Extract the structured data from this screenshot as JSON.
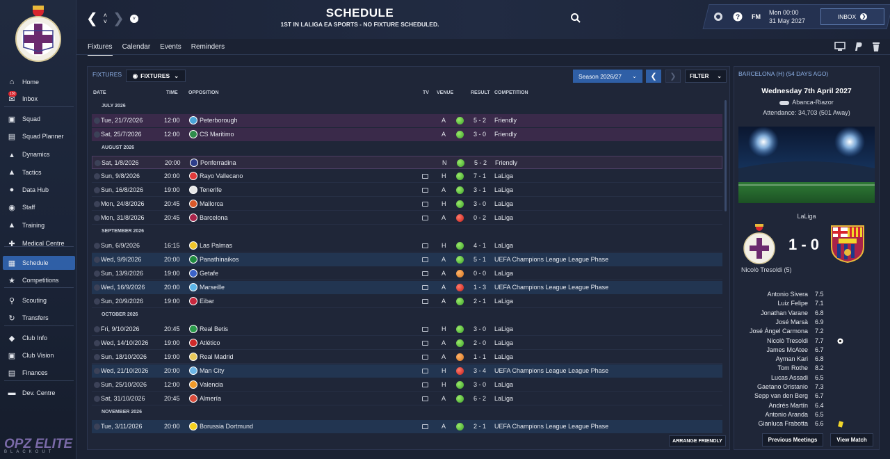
{
  "sidebar": {
    "items": [
      {
        "label": "Home",
        "icon": "home-icon"
      },
      {
        "label": "Inbox",
        "icon": "inbox-icon",
        "badge": "150"
      },
      {
        "label": "Squad",
        "icon": "shirt-icon"
      },
      {
        "label": "Squad Planner",
        "icon": "planner-icon"
      },
      {
        "label": "Dynamics",
        "icon": "dynamics-icon"
      },
      {
        "label": "Tactics",
        "icon": "tactics-icon"
      },
      {
        "label": "Data Hub",
        "icon": "data-hub-icon"
      },
      {
        "label": "Staff",
        "icon": "staff-icon"
      },
      {
        "label": "Training",
        "icon": "training-icon"
      },
      {
        "label": "Medical Centre",
        "icon": "medical-icon"
      },
      {
        "label": "Schedule",
        "icon": "calendar-icon",
        "active": true
      },
      {
        "label": "Competitions",
        "icon": "trophy-icon"
      },
      {
        "label": "Scouting",
        "icon": "scouting-icon"
      },
      {
        "label": "Transfers",
        "icon": "transfers-icon"
      },
      {
        "label": "Club Info",
        "icon": "club-info-icon"
      },
      {
        "label": "Club Vision",
        "icon": "club-vision-icon"
      },
      {
        "label": "Finances",
        "icon": "finances-icon"
      },
      {
        "label": "Dev. Centre",
        "icon": "dev-centre-icon"
      }
    ],
    "brand_main": "OPZ ELITE",
    "brand_sub": "BLACKOUT"
  },
  "header": {
    "title": "SCHEDULE",
    "subtitle": "1ST IN LALIGA EA SPORTS - NO FIXTURE SCHEDULED.",
    "fm_label": "FM",
    "day_time": "Mon 00:00",
    "date": "31 May 2027",
    "inbox_label": "INBOX"
  },
  "tabs": [
    "Fixtures",
    "Calendar",
    "Events",
    "Reminders"
  ],
  "panel": {
    "label": "FIXTURES",
    "view_dropdown": "FIXTURES",
    "season": "Season 2026/27",
    "filter": "FILTER",
    "arrange_label": "ARRANGE FRIENDLY",
    "columns": {
      "date": "DATE",
      "time": "TIME",
      "opposition": "OPPOSITION",
      "tv": "TV",
      "venue": "VENUE",
      "result": "RESULT",
      "competition": "COMPETITION"
    }
  },
  "fixtures": [
    {
      "section": "JULY 2026"
    },
    {
      "date": "Tue, 21/7/2026",
      "time": "12:00",
      "opp": "Peterborough",
      "tv": false,
      "venue": "A",
      "outcome": "win",
      "result": "5 - 2",
      "comp": "Friendly",
      "style": "friendly",
      "logo": "#4aa4d8"
    },
    {
      "date": "Sat, 25/7/2026",
      "time": "12:00",
      "opp": "CS Maritimo",
      "tv": false,
      "venue": "A",
      "outcome": "win",
      "result": "3 - 0",
      "comp": "Friendly",
      "style": "friendly",
      "logo": "#2e8b4a"
    },
    {
      "section": "AUGUST 2026"
    },
    {
      "date": "Sat, 1/8/2026",
      "time": "20:00",
      "opp": "Ponferradina",
      "tv": false,
      "venue": "N",
      "outcome": "win",
      "result": "5 - 2",
      "comp": "Friendly",
      "style": "friendly-light",
      "logo": "#2d3d8a"
    },
    {
      "date": "Sun, 9/8/2026",
      "time": "20:00",
      "opp": "Rayo Vallecano",
      "tv": true,
      "venue": "H",
      "outcome": "win",
      "result": "7 - 1",
      "comp": "LaLiga",
      "style": "plain",
      "logo": "#e23a3a"
    },
    {
      "date": "Sun, 16/8/2026",
      "time": "19:00",
      "opp": "Tenerife",
      "tv": true,
      "venue": "A",
      "outcome": "win",
      "result": "3 - 1",
      "comp": "LaLiga",
      "style": "plain",
      "logo": "#e7e7e7"
    },
    {
      "date": "Mon, 24/8/2026",
      "time": "20:45",
      "opp": "Mallorca",
      "tv": true,
      "venue": "H",
      "outcome": "win",
      "result": "3 - 0",
      "comp": "LaLiga",
      "style": "plain",
      "logo": "#d8582a"
    },
    {
      "date": "Mon, 31/8/2026",
      "time": "20:45",
      "opp": "Barcelona",
      "tv": true,
      "venue": "A",
      "outcome": "loss",
      "result": "0 - 2",
      "comp": "LaLiga",
      "style": "plain",
      "logo": "#a8234a"
    },
    {
      "section": "SEPTEMBER 2026"
    },
    {
      "date": "Sun, 6/9/2026",
      "time": "16:15",
      "opp": "Las Palmas",
      "tv": true,
      "venue": "H",
      "outcome": "win",
      "result": "4 - 1",
      "comp": "LaLiga",
      "style": "plain",
      "logo": "#f0c52a"
    },
    {
      "date": "Wed, 9/9/2026",
      "time": "20:00",
      "opp": "Panathinaikos",
      "tv": true,
      "venue": "A",
      "outcome": "win",
      "result": "5 - 1",
      "comp": "UEFA Champions League League Phase",
      "style": "ucl",
      "logo": "#1e8a3e"
    },
    {
      "date": "Sun, 13/9/2026",
      "time": "19:00",
      "opp": "Getafe",
      "tv": true,
      "venue": "A",
      "outcome": "draw",
      "result": "0 - 0",
      "comp": "LaLiga",
      "style": "plain",
      "logo": "#3a62c8"
    },
    {
      "date": "Wed, 16/9/2026",
      "time": "20:00",
      "opp": "Marseille",
      "tv": true,
      "venue": "A",
      "outcome": "loss",
      "result": "1 - 3",
      "comp": "UEFA Champions League League Phase",
      "style": "ucl",
      "logo": "#5bb5e8"
    },
    {
      "date": "Sun, 20/9/2026",
      "time": "19:00",
      "opp": "Eibar",
      "tv": true,
      "venue": "A",
      "outcome": "win",
      "result": "2 - 1",
      "comp": "LaLiga",
      "style": "plain",
      "logo": "#c8283e"
    },
    {
      "section": "OCTOBER 2026"
    },
    {
      "date": "Fri, 9/10/2026",
      "time": "20:45",
      "opp": "Real Betis",
      "tv": true,
      "venue": "H",
      "outcome": "win",
      "result": "3 - 0",
      "comp": "LaLiga",
      "style": "plain",
      "logo": "#2a9a4a"
    },
    {
      "date": "Wed, 14/10/2026",
      "time": "19:00",
      "opp": "Atlético",
      "tv": true,
      "venue": "A",
      "outcome": "win",
      "result": "2 - 0",
      "comp": "LaLiga",
      "style": "plain",
      "logo": "#d02a2a"
    },
    {
      "date": "Sun, 18/10/2026",
      "time": "19:00",
      "opp": "Real Madrid",
      "tv": true,
      "venue": "A",
      "outcome": "draw",
      "result": "1 - 1",
      "comp": "LaLiga",
      "style": "plain",
      "logo": "#e8c85a"
    },
    {
      "date": "Wed, 21/10/2026",
      "time": "20:00",
      "opp": "Man City",
      "tv": true,
      "venue": "H",
      "outcome": "loss",
      "result": "3 - 4",
      "comp": "UEFA Champions League League Phase",
      "style": "ucl",
      "logo": "#6cb6e6"
    },
    {
      "date": "Sun, 25/10/2026",
      "time": "12:00",
      "opp": "Valencia",
      "tv": true,
      "venue": "H",
      "outcome": "win",
      "result": "3 - 0",
      "comp": "LaLiga",
      "style": "plain",
      "logo": "#f09a2a"
    },
    {
      "date": "Sat, 31/10/2026",
      "time": "20:45",
      "opp": "Almería",
      "tv": true,
      "venue": "A",
      "outcome": "win",
      "result": "6 - 2",
      "comp": "LaLiga",
      "style": "plain",
      "logo": "#d84a3a"
    },
    {
      "section": "NOVEMBER 2026"
    },
    {
      "date": "Tue, 3/11/2026",
      "time": "20:00",
      "opp": "Borussia Dortmund",
      "tv": true,
      "venue": "A",
      "outcome": "win",
      "result": "2 - 1",
      "comp": "UEFA Champions League League Phase",
      "style": "ucl",
      "logo": "#f6d21e"
    }
  ],
  "match": {
    "heading": "BARCELONA (H) (54 DAYS AGO)",
    "date": "Wednesday 7th April 2027",
    "venue": "Abanca-Riazor",
    "attendance": "Attendance: 34,703 (501 Away)",
    "competition": "LaLiga",
    "score": "1 - 0",
    "scorer": "Nicolò Tresoldi (5)",
    "lineup": [
      {
        "name": "Antonio Sivera",
        "rating": "7.5"
      },
      {
        "name": "Luiz Felipe",
        "rating": "7.1"
      },
      {
        "name": "Jonathan Varane",
        "rating": "6.8"
      },
      {
        "name": "José Marsà",
        "rating": "6.9"
      },
      {
        "name": "José Ángel Carmona",
        "rating": "7.2"
      },
      {
        "name": "Nicolò Tresoldi",
        "rating": "7.7",
        "goal": true
      },
      {
        "name": "James McAtee",
        "rating": "6.7"
      },
      {
        "name": "Ayman Kari",
        "rating": "6.8"
      },
      {
        "name": "Tom Rothe",
        "rating": "8.2"
      },
      {
        "name": "Lucas Assadi",
        "rating": "6.5"
      },
      {
        "name": "Gaetano Oristanio",
        "rating": "7.3"
      },
      {
        "name": "Sepp van den Berg",
        "rating": "6.7"
      },
      {
        "name": "Andrés Martín",
        "rating": "6.4"
      },
      {
        "name": "Antonio Aranda",
        "rating": "6.5"
      },
      {
        "name": "Gianluca Frabotta",
        "rating": "6.6",
        "yellow": true
      }
    ],
    "prev_label": "Previous Meetings",
    "view_label": "View Match"
  }
}
